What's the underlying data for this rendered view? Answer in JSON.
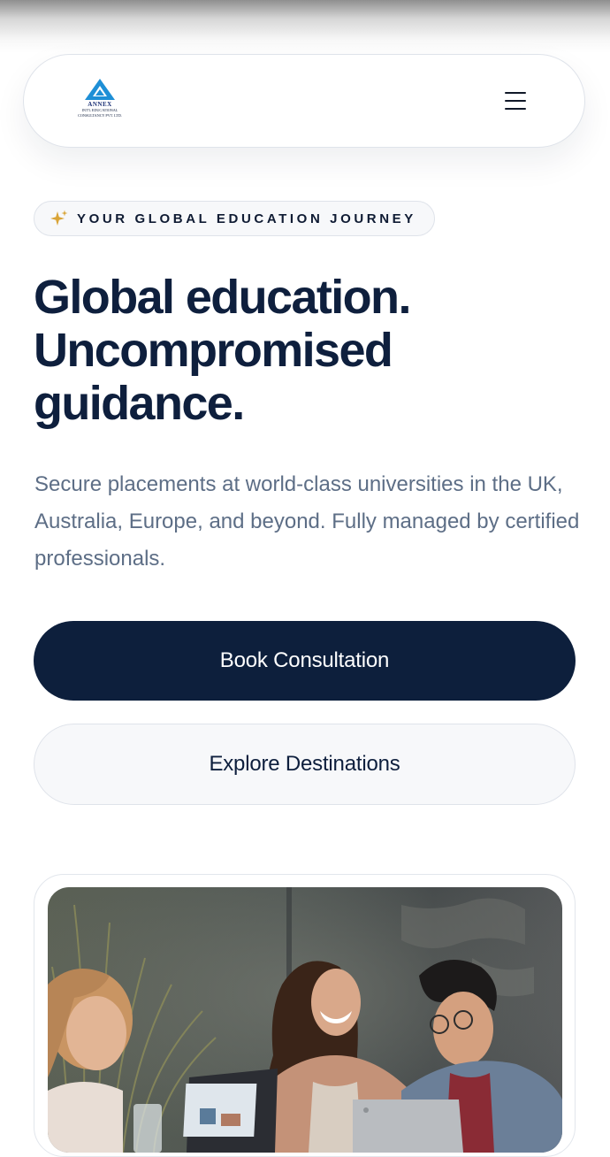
{
  "header": {
    "logo": {
      "name": "ANNEX",
      "subtitle_line1": "INT'L EDUCATIONAL",
      "subtitle_line2": "CONSULTANCY PVT. LTD."
    },
    "menu_icon": "hamburger-menu-icon"
  },
  "hero": {
    "badge_icon": "sparkle-icon",
    "badge": "YOUR GLOBAL EDUCATION JOURNEY",
    "title_lines": [
      "Global education.",
      "Uncompromised",
      "guidance."
    ],
    "description": "Secure placements at world-class universities in the UK, Australia, Europe, and beyond. Fully managed by certified professionals.",
    "primary_button": "Book Consultation",
    "secondary_button": "Explore Destinations"
  },
  "colors": {
    "navy": "#0d1f3c",
    "muted_text": "#5d6e86",
    "accent_gold": "#d9a437",
    "border": "#dfe3ea",
    "logo_blue": "#1e8fd6"
  }
}
